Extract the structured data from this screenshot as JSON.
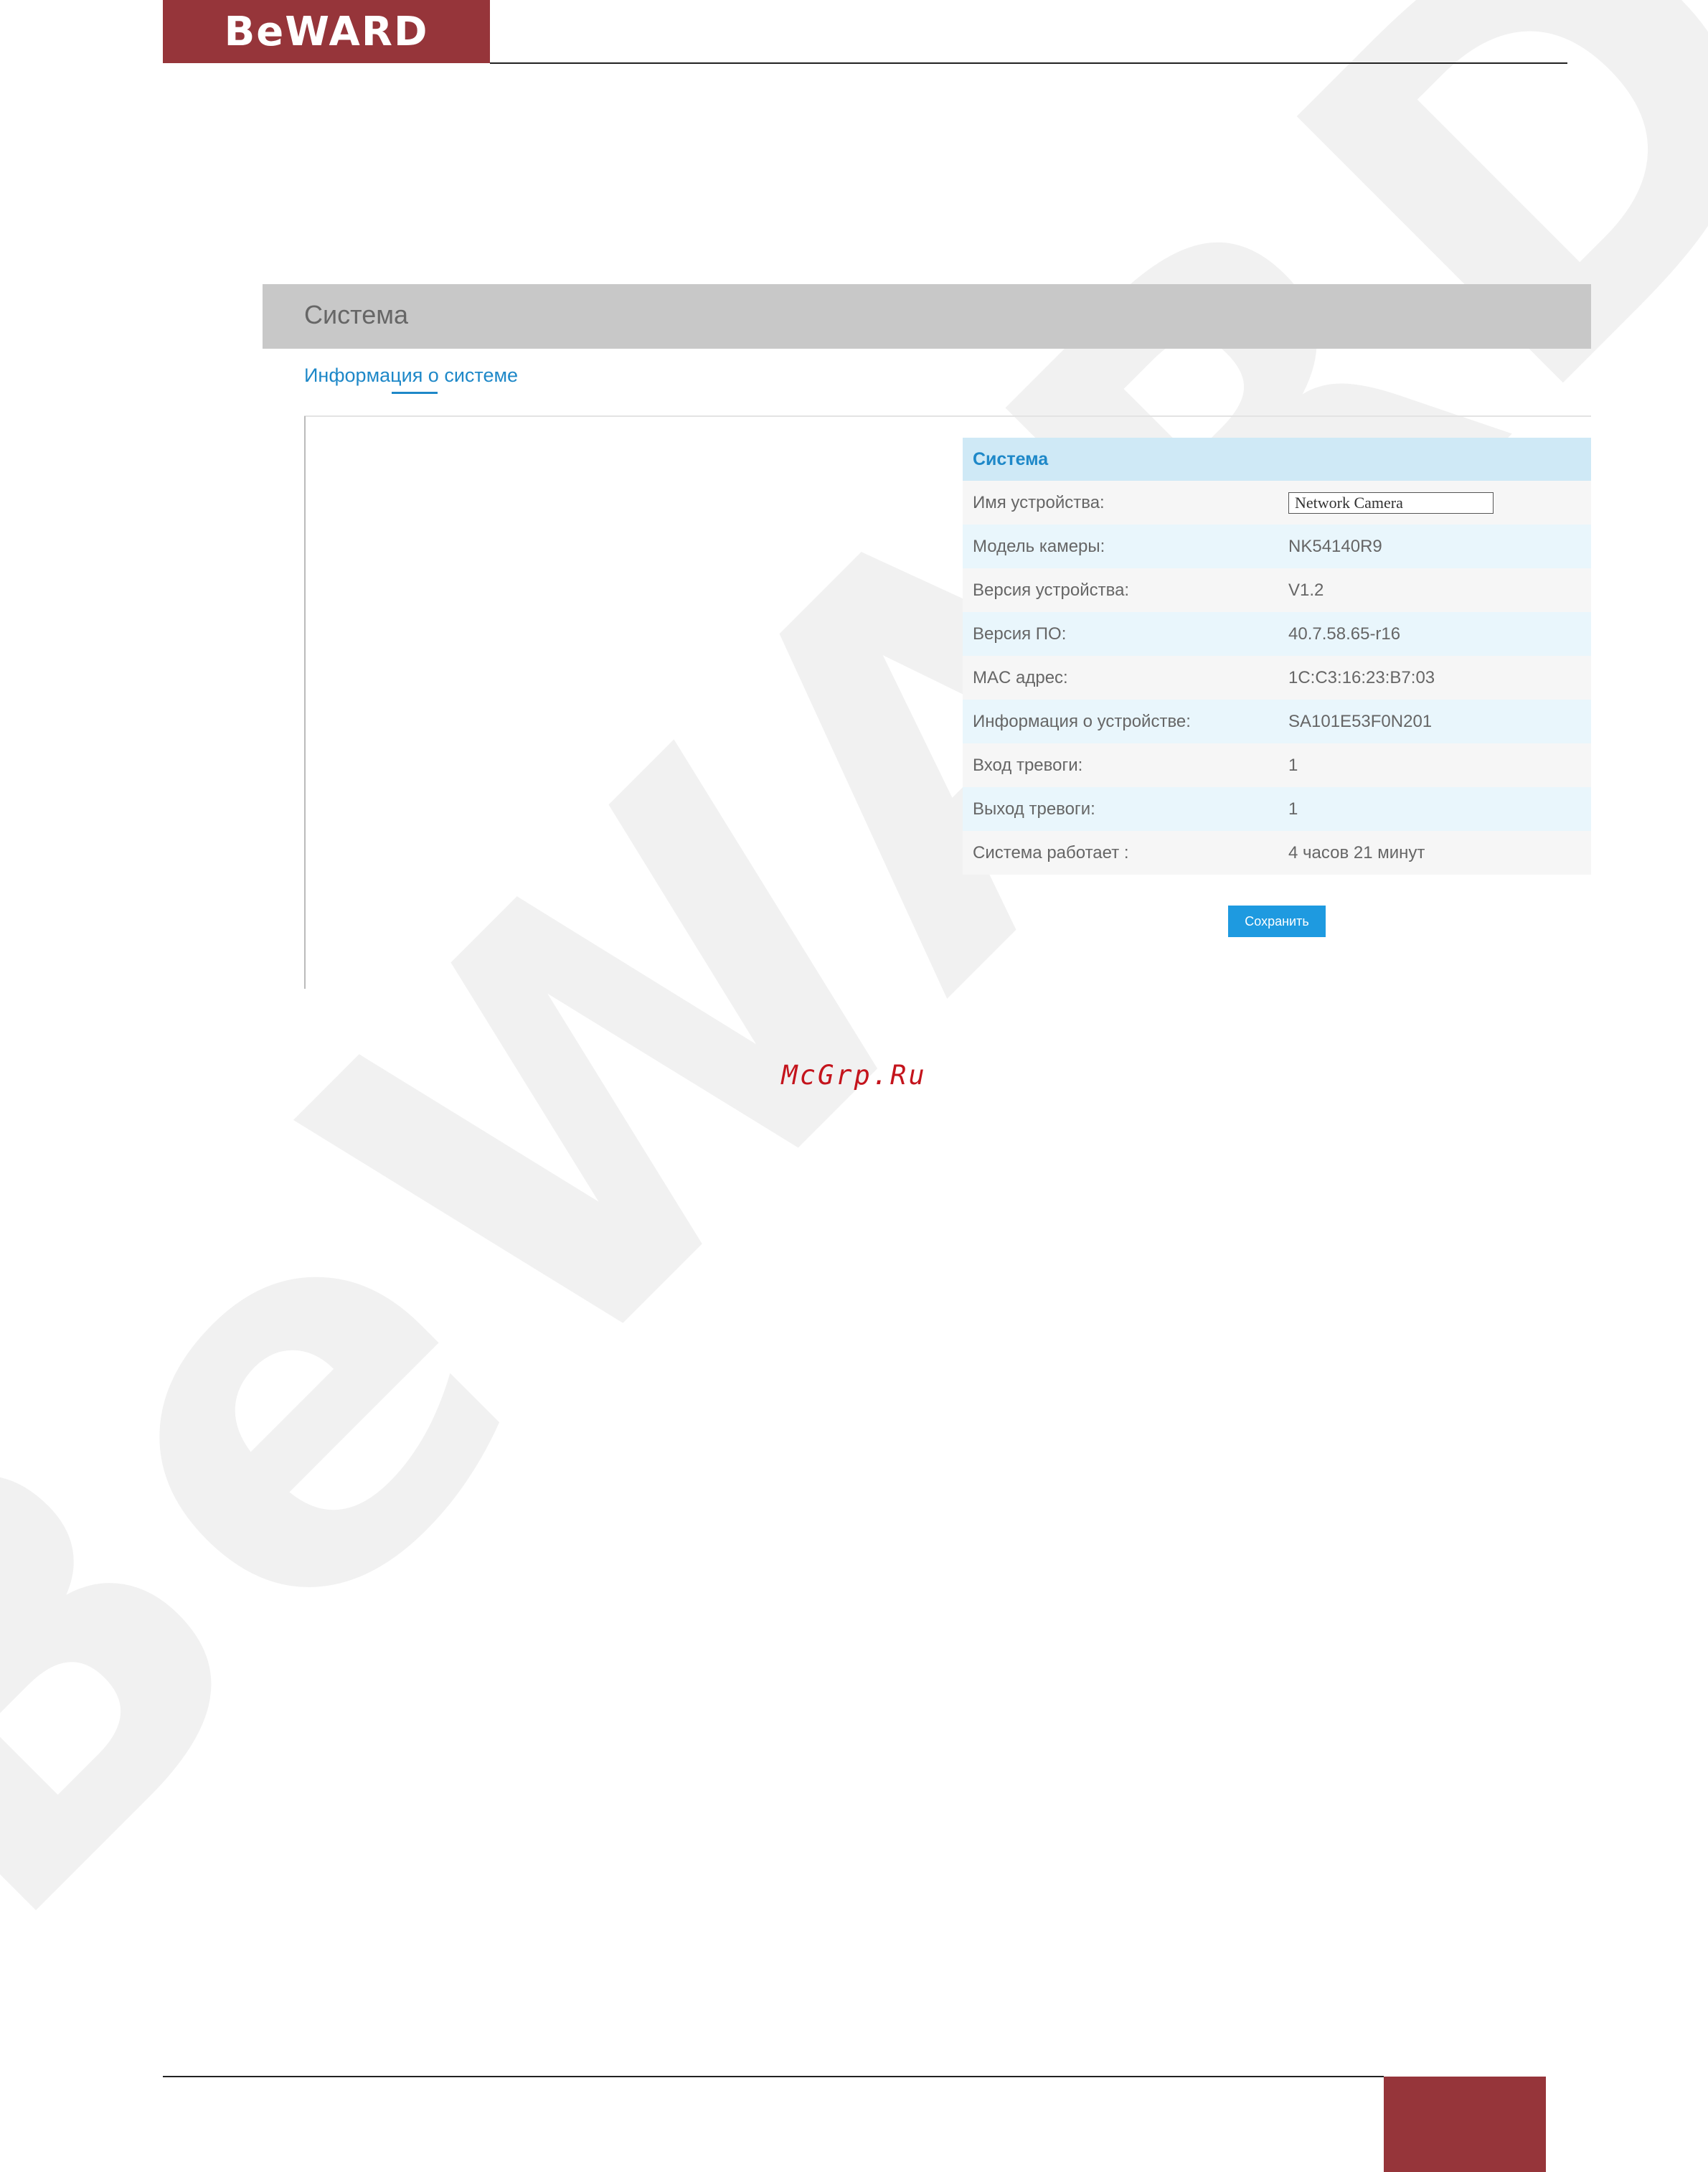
{
  "brand": {
    "logo_text": "BeWARD",
    "color": "#96353a"
  },
  "watermark": "BeWARD",
  "screenshot": {
    "title": "Система",
    "tab": "Информация о системе",
    "section_header": "Система",
    "rows": [
      {
        "label": "Имя устройства:",
        "value": "Network Camera",
        "editable": true
      },
      {
        "label": "Модель камеры:",
        "value": "NK54140R9"
      },
      {
        "label": "Версия устройства:",
        "value": "V1.2"
      },
      {
        "label": "Версия ПО:",
        "value": "40.7.58.65-r16"
      },
      {
        "label": "MAC адрес:",
        "value": "1C:C3:16:23:B7:03"
      },
      {
        "label": "Информация о устройстве:",
        "value": "SA101E53F0N201"
      },
      {
        "label": "Вход тревоги:",
        "value": "1"
      },
      {
        "label": "Выход тревоги:",
        "value": "1"
      },
      {
        "label": "Система работает :",
        "value": "4 часов 21 минут"
      }
    ],
    "save_button": "Сохранить",
    "accent_color": "#1e88c8"
  },
  "site_label": "McGrp.Ru"
}
